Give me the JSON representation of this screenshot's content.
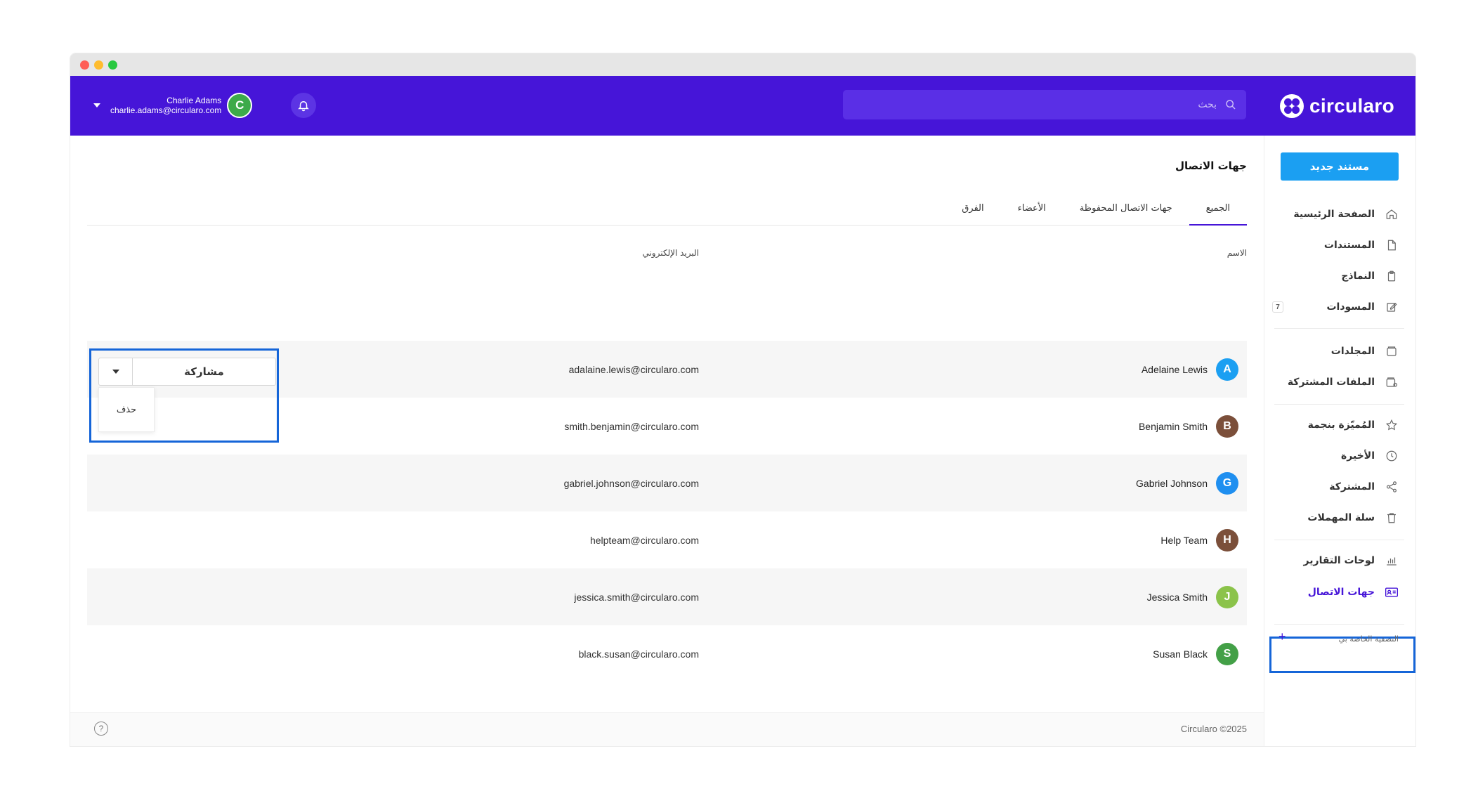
{
  "app": {
    "logo_text": "circularo"
  },
  "header": {
    "search_placeholder": "بحث",
    "user": {
      "name": "Charlie Adams",
      "email": "charlie.adams@circularo.com",
      "initial": "C",
      "avatar_color": "#3daa4a"
    }
  },
  "sidebar": {
    "new_document": "مستند جديد",
    "items": [
      {
        "label": "الصفحة الرئيسية",
        "icon": "home-icon"
      },
      {
        "label": "المستندات",
        "icon": "document-icon"
      },
      {
        "label": "النماذج",
        "icon": "clipboard-icon"
      },
      {
        "label": "المسودات",
        "icon": "edit-icon",
        "badge": "7"
      },
      {
        "label": "المجلدات",
        "icon": "folder-icon"
      },
      {
        "label": "الملفات المشتركة",
        "icon": "shared-folder-icon"
      },
      {
        "label": "المُميّزة بنجمة",
        "icon": "star-icon"
      },
      {
        "label": "الأخيرة",
        "icon": "clock-icon"
      },
      {
        "label": "المشتركة",
        "icon": "share-icon"
      },
      {
        "label": "سلة المهملات",
        "icon": "trash-icon"
      },
      {
        "label": "لوحات التقارير",
        "icon": "chart-icon"
      },
      {
        "label": "جهات الاتصال",
        "icon": "contact-card-icon"
      }
    ],
    "custom_filter": "التصفية الخاصة بي",
    "add": "+"
  },
  "main": {
    "title": "جهات الاتصال",
    "tabs": [
      "الجميع",
      "جهات الاتصال المحفوظة",
      "الأعضاء",
      "الفرق"
    ],
    "columns": {
      "name": "الاسم",
      "email": "البريد الإلكتروني"
    },
    "rows": [
      {
        "initial": "A",
        "name": "Adelaine Lewis",
        "email": "adalaine.lewis@circularo.com",
        "color": "#1b9ff2"
      },
      {
        "initial": "B",
        "name": "Benjamin Smith",
        "email": "smith.benjamin@circularo.com",
        "color": "#7b4f3a"
      },
      {
        "initial": "G",
        "name": "Gabriel Johnson",
        "email": "gabriel.johnson@circularo.com",
        "color": "#1f8ff0"
      },
      {
        "initial": "H",
        "name": "Help Team",
        "email": "helpteam@circularo.com",
        "color": "#7b4f3a"
      },
      {
        "initial": "J",
        "name": "Jessica Smith",
        "email": "jessica.smith@circularo.com",
        "color": "#8bc34a"
      },
      {
        "initial": "S",
        "name": "Susan Black",
        "email": "black.susan@circularo.com",
        "color": "#43a047"
      }
    ],
    "share_button": "مشاركة",
    "share_menu": [
      "حذف"
    ]
  },
  "footer": {
    "copyright": "Circularo ©2025",
    "help": "?"
  },
  "colors": {
    "brand": "#4615d8",
    "accent": "#1b9ff2",
    "highlight": "#1565d8"
  }
}
